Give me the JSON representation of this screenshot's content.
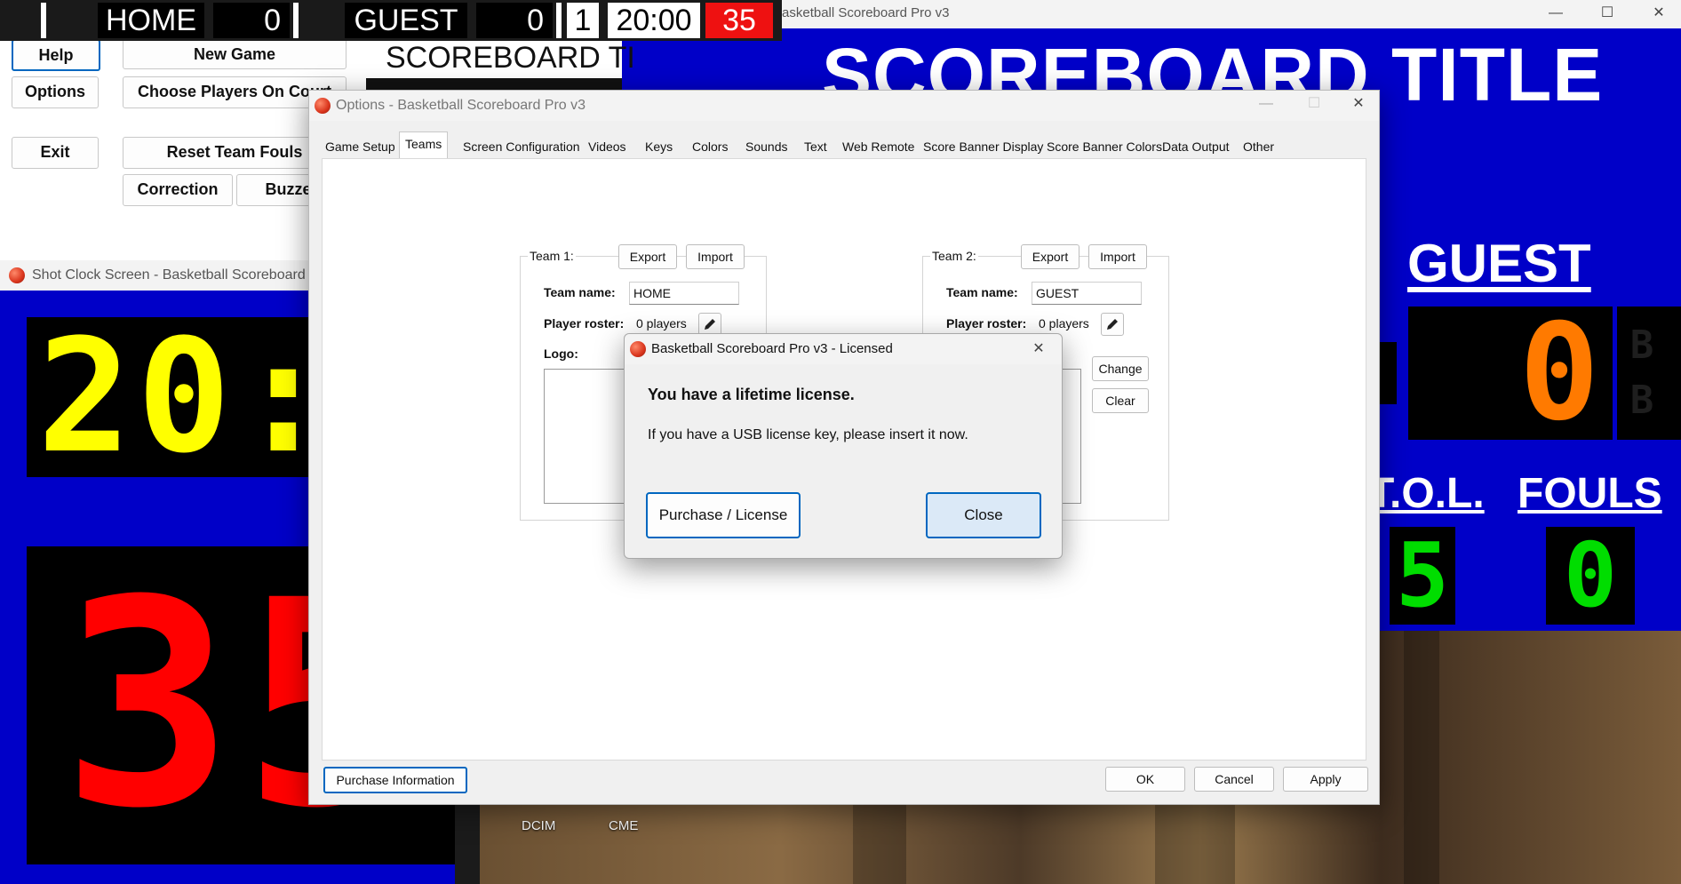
{
  "colors": {
    "scoreboard_blue": "#0000c8",
    "shot_clock_yellow": "#ffff00",
    "shot_clock_red": "#ff0000",
    "score_orange": "#ff7a00",
    "fouls_green": "#00dd00",
    "banner_red": "#ee1111",
    "focus_blue": "#0067c0"
  },
  "score_banner": {
    "home_name": "HOME",
    "home_score": "0",
    "guest_name": "GUEST",
    "guest_score": "0",
    "period": "1",
    "clock": "20:00",
    "shot_clock": "35"
  },
  "control_panel": {
    "help": "Help",
    "options": "Options",
    "exit": "Exit",
    "new_game": "New Game",
    "choose_players": "Choose Players On Court",
    "reset_team_fouls": "Reset Team Fouls",
    "correction": "Correction",
    "buzzer": "Buzzer",
    "scoreboard_title_preview": "SCOREBOARD TI"
  },
  "big_scoreboard": {
    "window_title": "Basketball Scoreboard Pro v3",
    "title": "SCOREBOARD TITLE",
    "guest_label": "GUEST",
    "guest_score": "0",
    "bonus_letters": [
      "B",
      "B"
    ],
    "tol_label": "T.O.L.",
    "fouls_label": "FOULS",
    "tol_value": "5",
    "fouls_value": "0",
    "minimize_icon": "minimize-icon",
    "maximize_icon": "maximize-icon",
    "close_icon": "close-icon"
  },
  "shot_clock_window": {
    "title": "Shot Clock Screen - Basketball Scoreboard Pro v3",
    "game_clock": "20:00",
    "shot_clock": "35"
  },
  "desktop": {
    "icons": [
      "DCIM",
      "CME"
    ]
  },
  "options_window": {
    "title": "Options - Basketball Scoreboard Pro v3",
    "tabs": [
      "Game Setup",
      "Teams",
      "Screen Configuration",
      "Videos",
      "Keys",
      "Colors",
      "Sounds",
      "Text",
      "Web Remote",
      "Score Banner Display",
      "Score Banner Colors",
      "Data Output",
      "Other"
    ],
    "active_tab": "Teams",
    "team1": {
      "group_label": "Team 1:",
      "export": "Export",
      "import": "Import",
      "team_name_label": "Team name:",
      "team_name": "HOME",
      "roster_label": "Player roster:",
      "roster_value": "0 players",
      "logo_label": "Logo:"
    },
    "team2": {
      "group_label": "Team 2:",
      "export": "Export",
      "import": "Import",
      "team_name_label": "Team name:",
      "team_name": "GUEST",
      "roster_label": "Player roster:",
      "roster_value": "0 players",
      "change": "Change",
      "clear": "Clear"
    },
    "purchase_info": "Purchase Information",
    "ok": "OK",
    "cancel": "Cancel",
    "apply": "Apply"
  },
  "license_dialog": {
    "title": "Basketball Scoreboard Pro v3 - Licensed",
    "heading": "You have a lifetime license.",
    "message": "If you have a USB license key, please insert it now.",
    "purchase_button": "Purchase / License",
    "close_button": "Close"
  }
}
